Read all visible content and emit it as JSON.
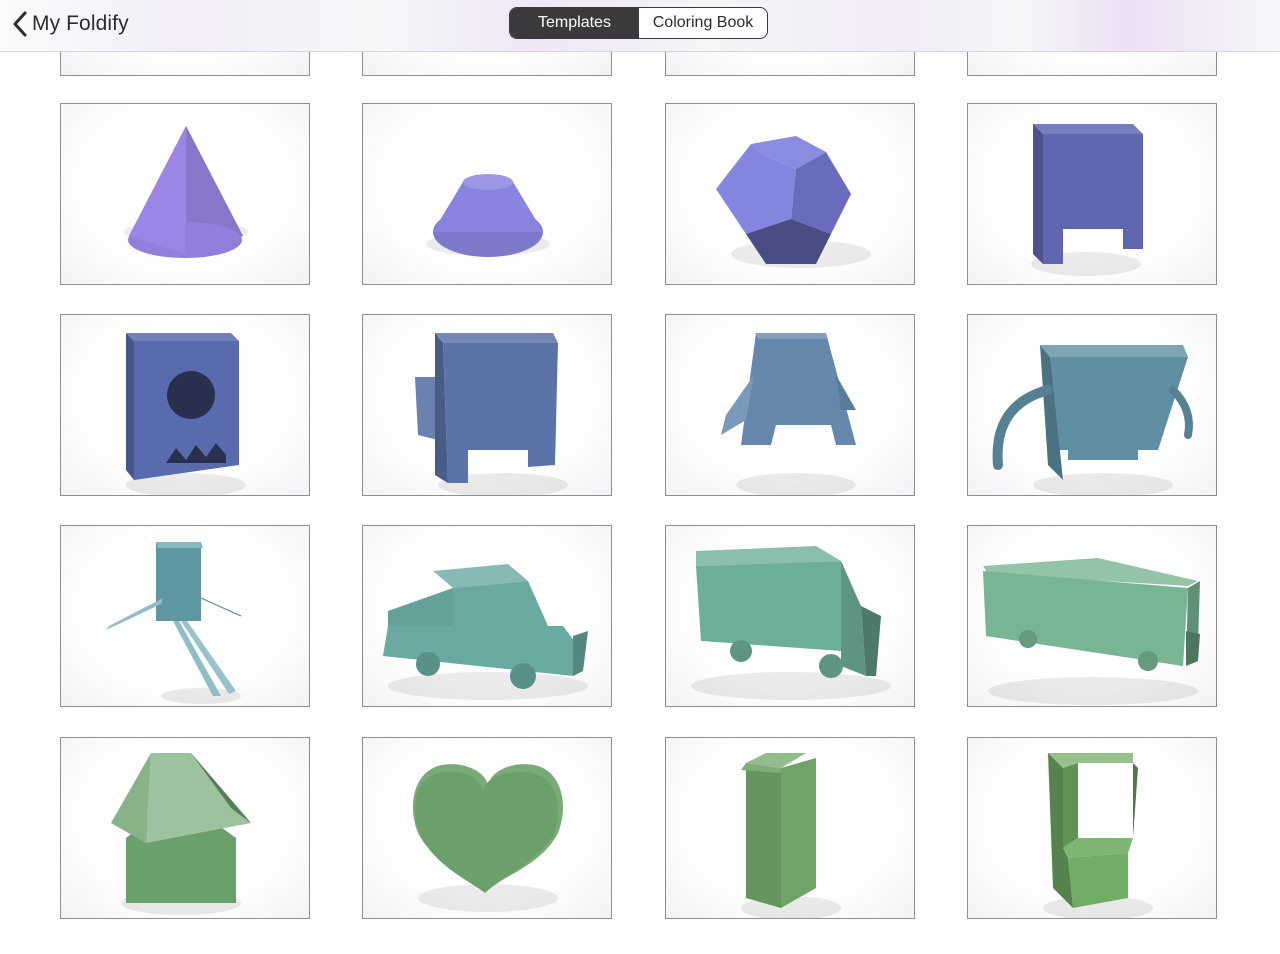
{
  "nav": {
    "back_label": "My Foldify",
    "segments": [
      {
        "label": "Templates",
        "selected": true
      },
      {
        "label": "Coloring Book",
        "selected": false
      }
    ]
  },
  "templates": [
    {
      "name": "partial-1",
      "shape": "partial",
      "color": "#b18ee0"
    },
    {
      "name": "partial-2",
      "shape": "partial",
      "color": "#ffffff"
    },
    {
      "name": "partial-3",
      "shape": "partial",
      "color": "#ffffff"
    },
    {
      "name": "partial-4",
      "shape": "partial",
      "color": "#ffffff"
    },
    {
      "name": "cone",
      "shape": "cone",
      "color": "#9b86e6"
    },
    {
      "name": "truncated-cone",
      "shape": "frustum",
      "color": "#8a84e0"
    },
    {
      "name": "dodecahedron",
      "shape": "dodeca",
      "color": "#7c7fdc"
    },
    {
      "name": "box-legs",
      "shape": "boxlegs",
      "color": "#5e67b0"
    },
    {
      "name": "monster-mouth",
      "shape": "monster",
      "color": "#5a6aae"
    },
    {
      "name": "box-robot-arms",
      "shape": "robot",
      "color": "#5b73a6"
    },
    {
      "name": "penguin",
      "shape": "penguin",
      "color": "#6487ab"
    },
    {
      "name": "creature-arms",
      "shape": "creature",
      "color": "#5f8fa3"
    },
    {
      "name": "stick-figure",
      "shape": "stick",
      "color": "#6aa8b3"
    },
    {
      "name": "car",
      "shape": "car",
      "color": "#6aa9a2"
    },
    {
      "name": "van",
      "shape": "van",
      "color": "#6eaf98"
    },
    {
      "name": "truck",
      "shape": "truck",
      "color": "#78b592"
    },
    {
      "name": "house",
      "shape": "house",
      "color": "#6aa06c"
    },
    {
      "name": "heart",
      "shape": "heart",
      "color": "#6ca06b"
    },
    {
      "name": "milk-carton",
      "shape": "carton",
      "color": "#6ea566"
    },
    {
      "name": "arcade-cabinet",
      "shape": "arcade",
      "color": "#72ad66"
    }
  ]
}
